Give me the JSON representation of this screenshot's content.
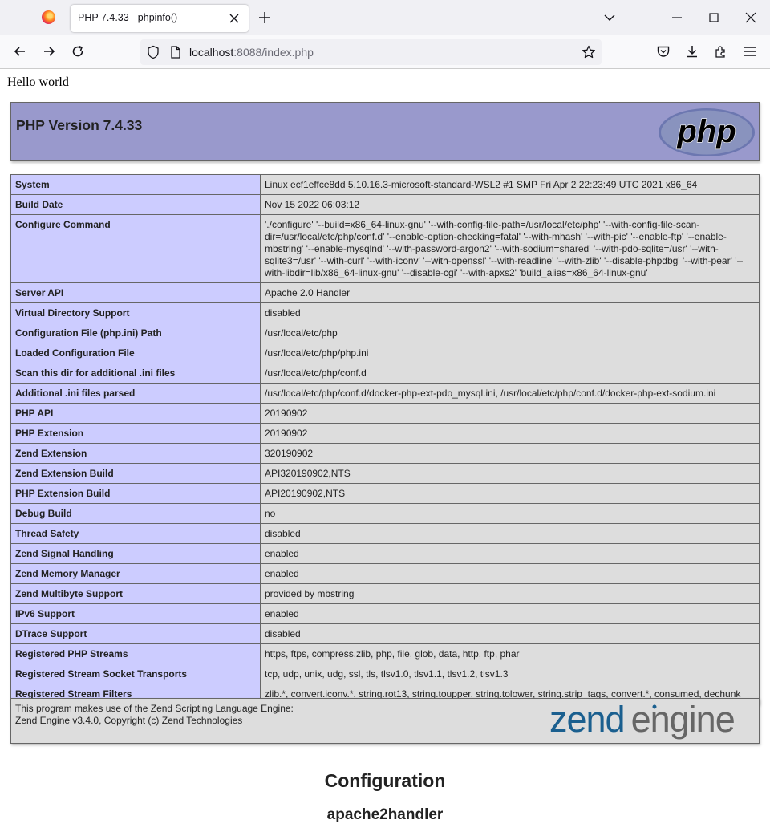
{
  "browser": {
    "tab_title": "PHP 7.4.33 - phpinfo()",
    "url_host": "localhost",
    "url_rest": ":8088/index.php"
  },
  "page": {
    "hello": "Hello world",
    "php_version": "PHP Version 7.4.33",
    "php_logo_text": "php",
    "info_rows": [
      {
        "label": "System",
        "value": "Linux ecf1effce8dd 5.10.16.3-microsoft-standard-WSL2 #1 SMP Fri Apr 2 22:23:49 UTC 2021 x86_64"
      },
      {
        "label": "Build Date",
        "value": "Nov 15 2022 06:03:12"
      },
      {
        "label": "Configure Command",
        "value": "'./configure' '--build=x86_64-linux-gnu' '--with-config-file-path=/usr/local/etc/php' '--with-config-file-scan-dir=/usr/local/etc/php/conf.d' '--enable-option-checking=fatal' '--with-mhash' '--with-pic' '--enable-ftp' '--enable-mbstring' '--enable-mysqlnd' '--with-password-argon2' '--with-sodium=shared' '--with-pdo-sqlite=/usr' '--with-sqlite3=/usr' '--with-curl' '--with-iconv' '--with-openssl' '--with-readline' '--with-zlib' '--disable-phpdbg' '--with-pear' '--with-libdir=lib/x86_64-linux-gnu' '--disable-cgi' '--with-apxs2' 'build_alias=x86_64-linux-gnu'"
      },
      {
        "label": "Server API",
        "value": "Apache 2.0 Handler"
      },
      {
        "label": "Virtual Directory Support",
        "value": "disabled"
      },
      {
        "label": "Configuration File (php.ini) Path",
        "value": "/usr/local/etc/php"
      },
      {
        "label": "Loaded Configuration File",
        "value": "/usr/local/etc/php/php.ini"
      },
      {
        "label": "Scan this dir for additional .ini files",
        "value": "/usr/local/etc/php/conf.d"
      },
      {
        "label": "Additional .ini files parsed",
        "value": "/usr/local/etc/php/conf.d/docker-php-ext-pdo_mysql.ini, /usr/local/etc/php/conf.d/docker-php-ext-sodium.ini"
      },
      {
        "label": "PHP API",
        "value": "20190902"
      },
      {
        "label": "PHP Extension",
        "value": "20190902"
      },
      {
        "label": "Zend Extension",
        "value": "320190902"
      },
      {
        "label": "Zend Extension Build",
        "value": "API320190902,NTS"
      },
      {
        "label": "PHP Extension Build",
        "value": "API20190902,NTS"
      },
      {
        "label": "Debug Build",
        "value": "no"
      },
      {
        "label": "Thread Safety",
        "value": "disabled"
      },
      {
        "label": "Zend Signal Handling",
        "value": "enabled"
      },
      {
        "label": "Zend Memory Manager",
        "value": "enabled"
      },
      {
        "label": "Zend Multibyte Support",
        "value": "provided by mbstring"
      },
      {
        "label": "IPv6 Support",
        "value": "enabled"
      },
      {
        "label": "DTrace Support",
        "value": "disabled"
      },
      {
        "label": "Registered PHP Streams",
        "value": "https, ftps, compress.zlib, php, file, glob, data, http, ftp, phar"
      },
      {
        "label": "Registered Stream Socket Transports",
        "value": "tcp, udp, unix, udg, ssl, tls, tlsv1.0, tlsv1.1, tlsv1.2, tlsv1.3"
      },
      {
        "label": "Registered Stream Filters",
        "value": "zlib.*, convert.iconv.*, string.rot13, string.toupper, string.tolower, string.strip_tags, convert.*, consumed, dechunk"
      }
    ],
    "zend_line1": "This program makes use of the Zend Scripting Language Engine:",
    "zend_line2": "Zend Engine v3.4.0, Copyright (c) Zend Technologies",
    "zend_logo_left": "zend",
    "zend_logo_right": "engine",
    "config_heading": "Configuration",
    "config_sub": "apache2handler"
  },
  "colors": {
    "header_bg": "#9999cc",
    "label_bg": "#ccccff",
    "value_bg": "#dddddd",
    "zend_blue": "#1a5f8f",
    "zend_gray": "#666666"
  },
  "icons": [
    "firefox-logo-icon",
    "close-icon",
    "plus-icon",
    "chevron-down-icon",
    "minimize-icon",
    "maximize-icon",
    "back-arrow-icon",
    "forward-arrow-icon",
    "reload-icon",
    "shield-icon",
    "page-icon",
    "star-icon",
    "pocket-icon",
    "download-icon",
    "extensions-icon",
    "menu-icon"
  ]
}
